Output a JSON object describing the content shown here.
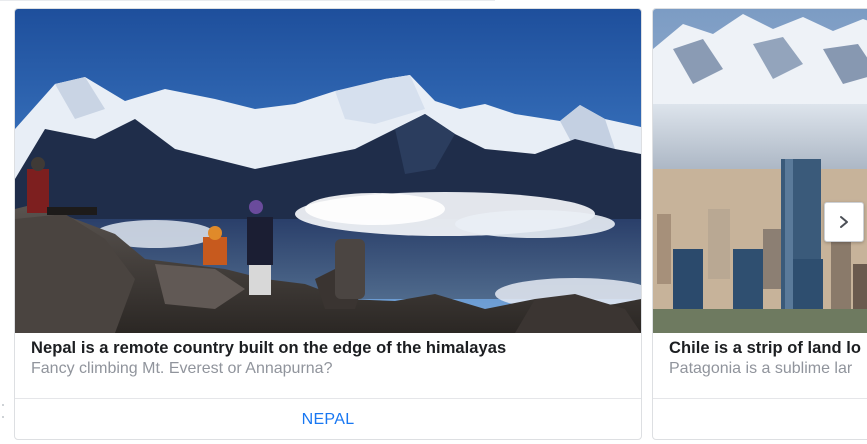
{
  "carousel": {
    "cards": [
      {
        "title": "Nepal is a remote country built on the edge of the himalayas",
        "subtitle": "Fancy climbing Mt. Everest or Annapurna?",
        "cta": "NEPAL"
      },
      {
        "title": "Chile is a strip of land lo",
        "subtitle": "Patagonia is a sublime lar",
        "cta": ""
      }
    ],
    "next_icon": "chevron-right-icon"
  },
  "colors": {
    "title": "#1c1e21",
    "subtitle": "#90949c",
    "cta": "#1877f2",
    "border": "#dddfe2"
  }
}
